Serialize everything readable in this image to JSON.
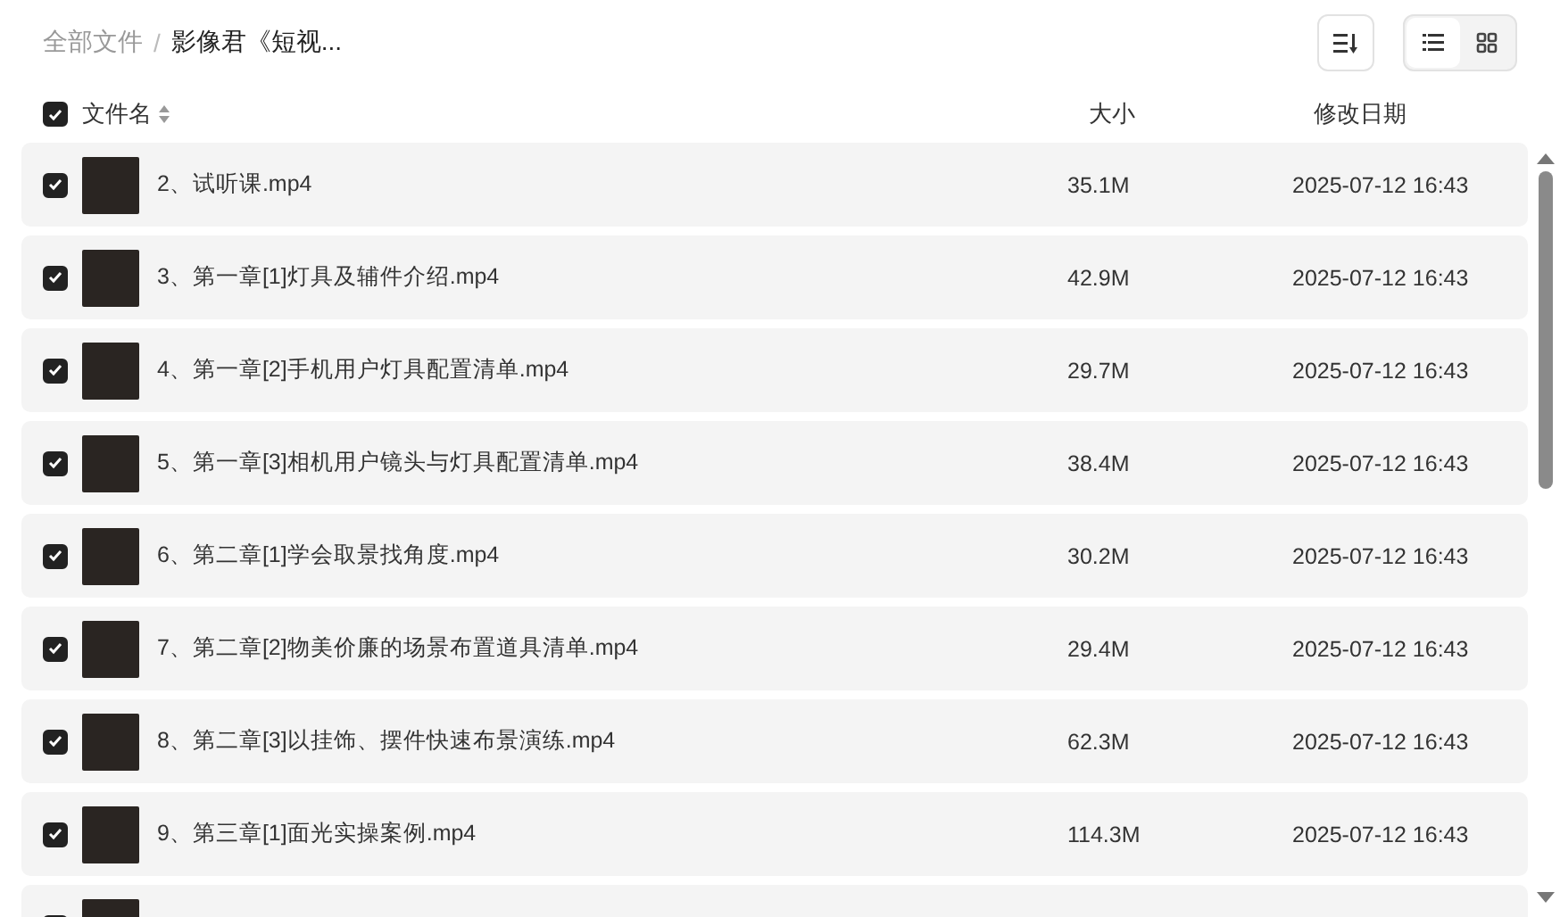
{
  "breadcrumb_separator": "/",
  "breadcrumb": [
    {
      "label": "全部文件",
      "selected": false
    },
    {
      "label": "影像君《短视...",
      "selected": true
    }
  ],
  "toolbar": {
    "view_modes": [
      {
        "kind": "list",
        "selected": true
      },
      {
        "kind": "grid",
        "selected": false
      }
    ]
  },
  "table": {
    "select_all": {
      "checked": true
    },
    "columns": [
      "文件名",
      "大小",
      "修改日期"
    ],
    "rows": [
      {
        "checked": true,
        "name": "2、试听课.mp4",
        "size": "35.1M",
        "modified": "2025-07-12 16:43"
      },
      {
        "checked": true,
        "name": "3、第一章[1]灯具及辅件介绍.mp4",
        "size": "42.9M",
        "modified": "2025-07-12 16:43"
      },
      {
        "checked": true,
        "name": "4、第一章[2]手机用户灯具配置清单.mp4",
        "size": "29.7M",
        "modified": "2025-07-12 16:43"
      },
      {
        "checked": true,
        "name": "5、第一章[3]相机用户镜头与灯具配置清单.mp4",
        "size": "38.4M",
        "modified": "2025-07-12 16:43"
      },
      {
        "checked": true,
        "name": "6、第二章[1]学会取景找角度.mp4",
        "size": "30.2M",
        "modified": "2025-07-12 16:43"
      },
      {
        "checked": true,
        "name": "7、第二章[2]物美价廉的场景布置道具清单.mp4",
        "size": "29.4M",
        "modified": "2025-07-12 16:43"
      },
      {
        "checked": true,
        "name": "8、第二章[3]以挂饰、摆件快速布景演练.mp4",
        "size": "62.3M",
        "modified": "2025-07-12 16:43"
      },
      {
        "checked": true,
        "name": "9、第三章[1]面光实操案例.mp4",
        "size": "114.3M",
        "modified": "2025-07-12 16:43"
      }
    ],
    "partial_rows": [
      {
        "checked": true
      }
    ]
  }
}
